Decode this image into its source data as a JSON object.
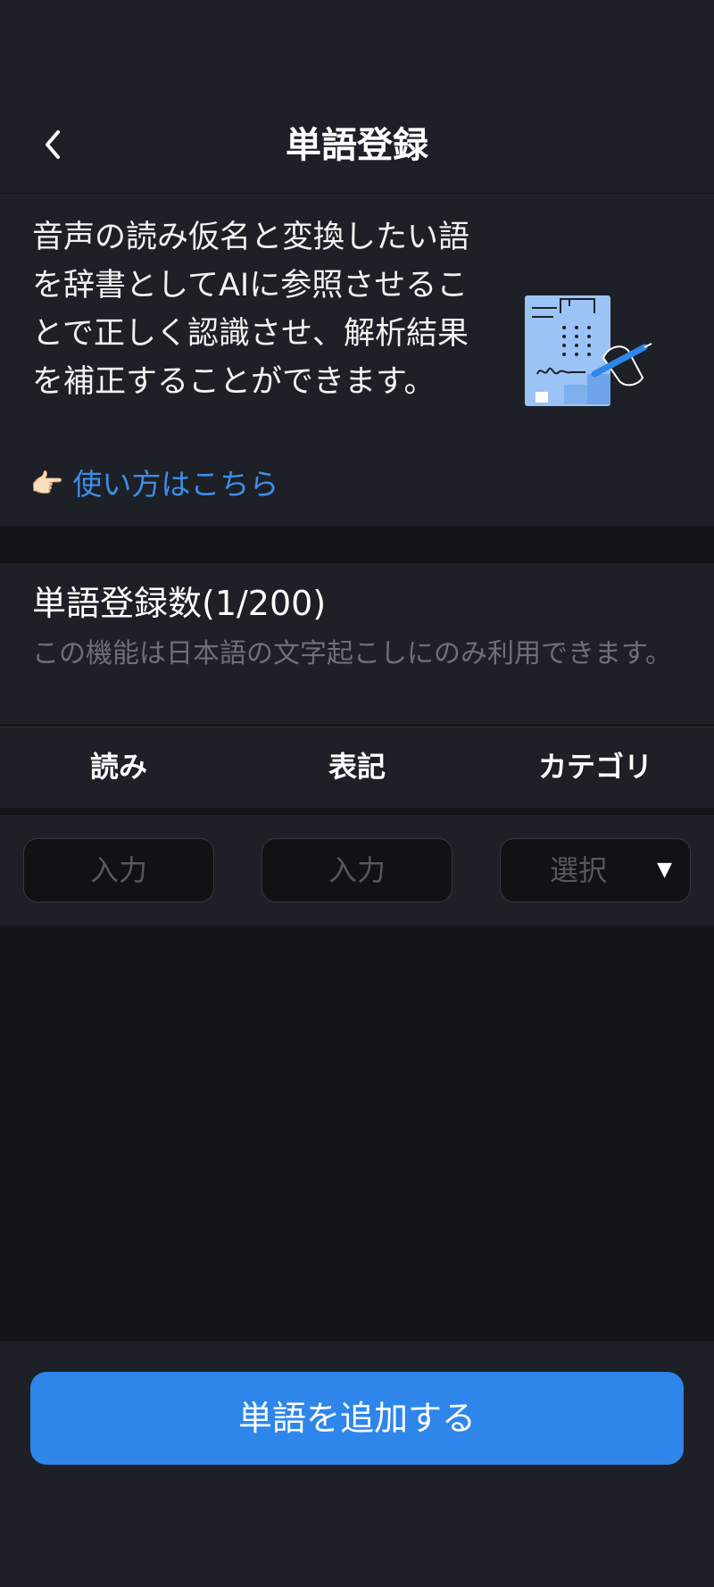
{
  "header": {
    "title": "単語登録"
  },
  "intro": {
    "description": "音声の読み仮名と変換したい語を辞書としてAIに参照させることで正しく認識させ、解析結果を補正することができます。",
    "howto_icon": "👉🏻",
    "howto_label": "使い方はこちら"
  },
  "registration": {
    "count_title": "単語登録数(1/200)",
    "note": "この機能は日本語の文字起こしにのみ利用できます。"
  },
  "table": {
    "columns": [
      "読み",
      "表記",
      "カテゴリ"
    ],
    "reading_placeholder": "入力",
    "notation_placeholder": "入力",
    "category_placeholder": "選択"
  },
  "footer": {
    "add_button_label": "単語を追加する"
  },
  "colors": {
    "accent": "#2f86ea",
    "link": "#3e8ee8",
    "panel": "#1d2026",
    "background": "#141518"
  },
  "icons": {
    "back": "chevron-left-icon",
    "howto": "pointing-hand-icon",
    "dropdown": "triangle-down-icon",
    "illustration": "document-signing-illustration"
  }
}
